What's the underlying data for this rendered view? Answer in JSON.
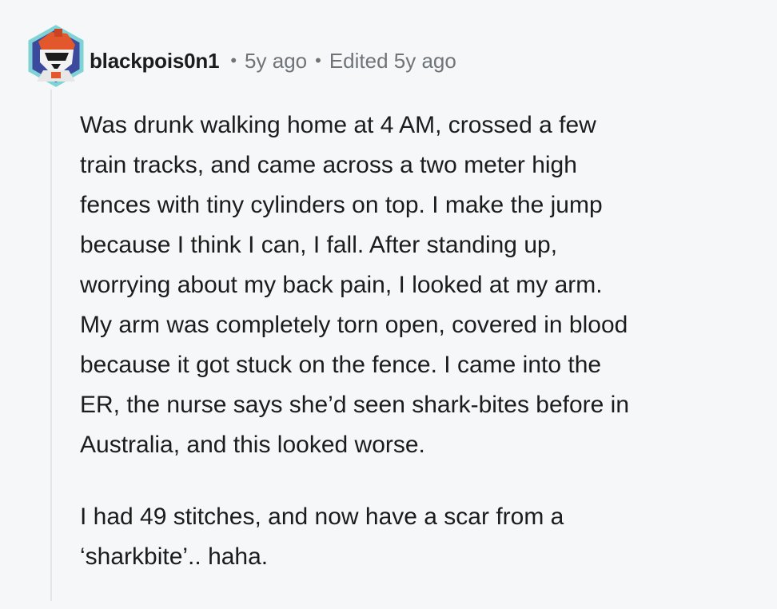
{
  "comment": {
    "username": "blackpois0n1",
    "separator": "•",
    "posted_time": "5y ago",
    "edited_label": "Edited 5y ago",
    "paragraphs": [
      {
        "lines": [
          "Was drunk walking home at 4 AM, crossed a few",
          "train tracks, and came across a two meter high",
          "fences with tiny cylinders on top. I make the jump",
          "because I think I can, I fall. After standing up,",
          "worrying about my back pain, I looked at my arm.",
          "My arm was completely torn open, covered in blood",
          "because it got stuck on the fence. I came into the",
          "ER, the nurse says she’d seen shark-bites before in",
          "Australia, and this looked worse."
        ]
      },
      {
        "lines": [
          "I had 49 stitches, and now have a scar from a",
          "‘sharkbite’.. haha."
        ]
      }
    ]
  },
  "avatar": {
    "icon": "snoo-robot-avatar-icon",
    "colors": {
      "hex_border": "#7fd3d6",
      "hex_fill": "#3b4a9c",
      "accent": "#e2572b"
    }
  }
}
